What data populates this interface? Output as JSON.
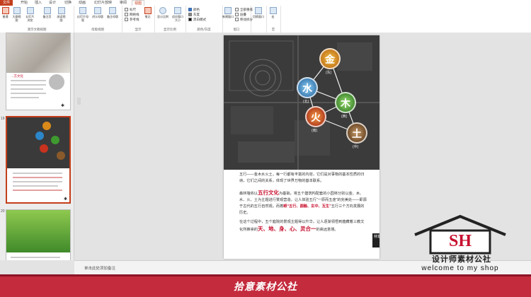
{
  "tabs": [
    {
      "label": "文件"
    },
    {
      "label": "开始"
    },
    {
      "label": "插入"
    },
    {
      "label": "设计"
    },
    {
      "label": "切换"
    },
    {
      "label": "动画"
    },
    {
      "label": "幻灯片放映"
    },
    {
      "label": "审阅"
    },
    {
      "label": "视图"
    }
  ],
  "ribbon": {
    "groups": [
      {
        "label": "演示文稿视图",
        "buttons": [
          "普通",
          "大纲视图",
          "幻灯片浏览",
          "备注页",
          "阅读视图"
        ]
      },
      {
        "label": "母版视图",
        "buttons": [
          "幻灯片母版",
          "讲义母版",
          "备注母版"
        ]
      },
      {
        "label": "显示",
        "checks": [
          "标尺",
          "网格线",
          "参考线"
        ],
        "buttons": [
          "笔记"
        ]
      },
      {
        "label": "显示比例",
        "buttons": [
          "显示比例",
          "适应窗口大小"
        ]
      },
      {
        "label": "颜色/灰度",
        "options": [
          "颜色",
          "灰度",
          "黑白模式"
        ]
      },
      {
        "label": "窗口",
        "buttons": [
          "新建窗口"
        ],
        "options": [
          "全部重排",
          "层叠",
          "移动拆分"
        ]
      },
      {
        "label": "",
        "buttons": [
          "切换窗口"
        ]
      },
      {
        "label": "宏",
        "buttons": [
          "宏"
        ]
      }
    ]
  },
  "thumbnails": [
    {
      "num": "",
      "caption": "…方文化"
    },
    {
      "num": "19",
      "caption": "五行文化"
    },
    {
      "num": "20",
      "caption": ""
    }
  ],
  "slide": {
    "elements": [
      {
        "glyph": "金",
        "sub": "(东)",
        "color": "#d98a1a"
      },
      {
        "glyph": "水",
        "sub": "(北)",
        "color": "#2c86c9"
      },
      {
        "glyph": "木",
        "sub": "(西)",
        "color": "#3e9a2e"
      },
      {
        "glyph": "火",
        "sub": "(南)",
        "color": "#c8321e"
      },
      {
        "glyph": "土",
        "sub": "(中)",
        "color": "#8b5a2b"
      }
    ],
    "para1": "五行——金木水火土，每一行都有丰富的内容，它们是对事物的基本性质的归纳，它们之间的关系，体现了世界万物的基本联系。",
    "para2_a": "森林墙依以",
    "para2_hl": "五行文化",
    "para2_b": "为基础，将五个建筑构配套的小园林分别以金、木、水、火、土为主题进行景观营造，让人体验五行“一原而五途”的完美处——即源于古代的五行自然观，而着",
    "para2_c": "眼“五行、圆融、玄中、互生”",
    "para2_d": "五行三个方向发展的历史。",
    "para3_a": "在这个过程中，五个庭院的景观主题得以升华，让人逐渐领悟到蕴藏",
    "para3_b": "着三教文化所推崇的",
    "para3_big": "天、地、身、心、灵合一",
    "para3_c": "的高远意境。",
    "seal": "林景"
  },
  "notes_placeholder": "单击此处添加备注",
  "watermark": {
    "logo_letters": "SH",
    "company": "设计师素材公社",
    "slogan": "welcome to my shop"
  },
  "banner": "拾意素材公社"
}
